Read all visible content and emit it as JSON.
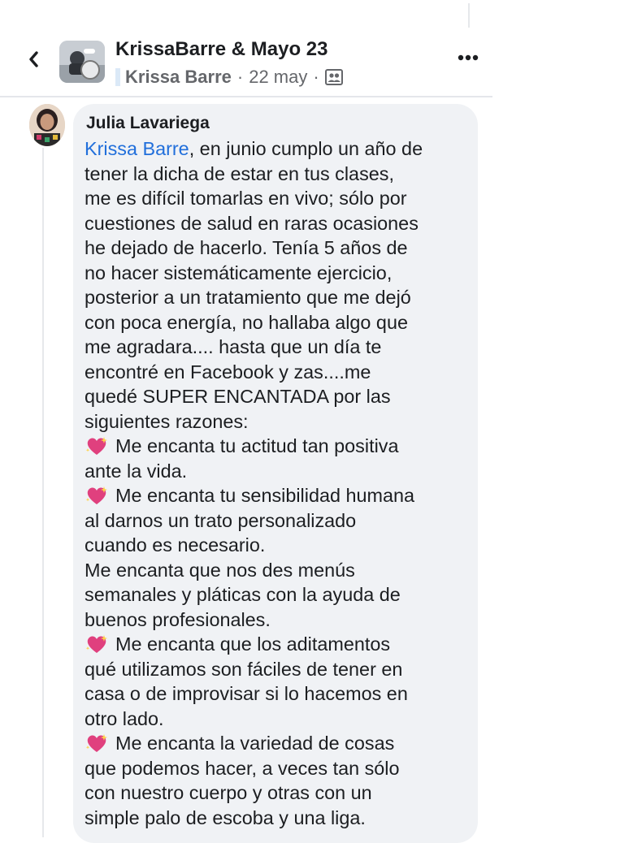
{
  "header": {
    "title": "KrissaBarre & Mayo 23",
    "author": "Krissa Barre",
    "separator": "·",
    "date": "22 may",
    "separator2": "·"
  },
  "comment": {
    "author": "Julia Lavariega",
    "mention": "Krissa Barre",
    "lines": [
      ", en junio cumplo un año de",
      "tener la dicha de estar en tus clases,",
      "me es difícil tomarlas en vivo; sólo por",
      "cuestiones de salud en raras ocasiones",
      "he dejado de hacerlo. Tenía 5 años de",
      "no hacer sistemáticamente ejercicio,",
      "posterior a un tratamiento que me dejó",
      "con poca energía, no hallaba algo que",
      "me agradara.... hasta que un día te",
      "encontré en Facebook y zas....me",
      "quedé SUPER ENCANTADA por las",
      "siguientes razones:",
      "Me encanta tu actitud tan positiva",
      "ante la vida.",
      "Me encanta tu sensibilidad humana",
      "al darnos un trato personalizado",
      "cuando es necesario.",
      "Me encanta que nos des menús",
      "semanales y pláticas con la ayuda de",
      "buenos profesionales.",
      "Me encanta que los aditamentos",
      "qué utilizamos son fáciles de tener en",
      "casa o de improvisar si lo hacemos en",
      "otro lado.",
      "Me encanta la variedad de cosas",
      "que podemos hacer, a veces tan sólo",
      "con nuestro cuerpo y otras con un",
      "simple palo de escoba y una liga."
    ]
  },
  "icons": {
    "back": "chevron-left-icon",
    "more": "more-horizontal-icon",
    "members": "members-icon",
    "heart": "sparkling-heart-emoji"
  },
  "colors": {
    "mention": "#216fdb",
    "bubble": "#f0f2f5",
    "secondary_text": "#65676b",
    "heart": "#e0407e"
  }
}
